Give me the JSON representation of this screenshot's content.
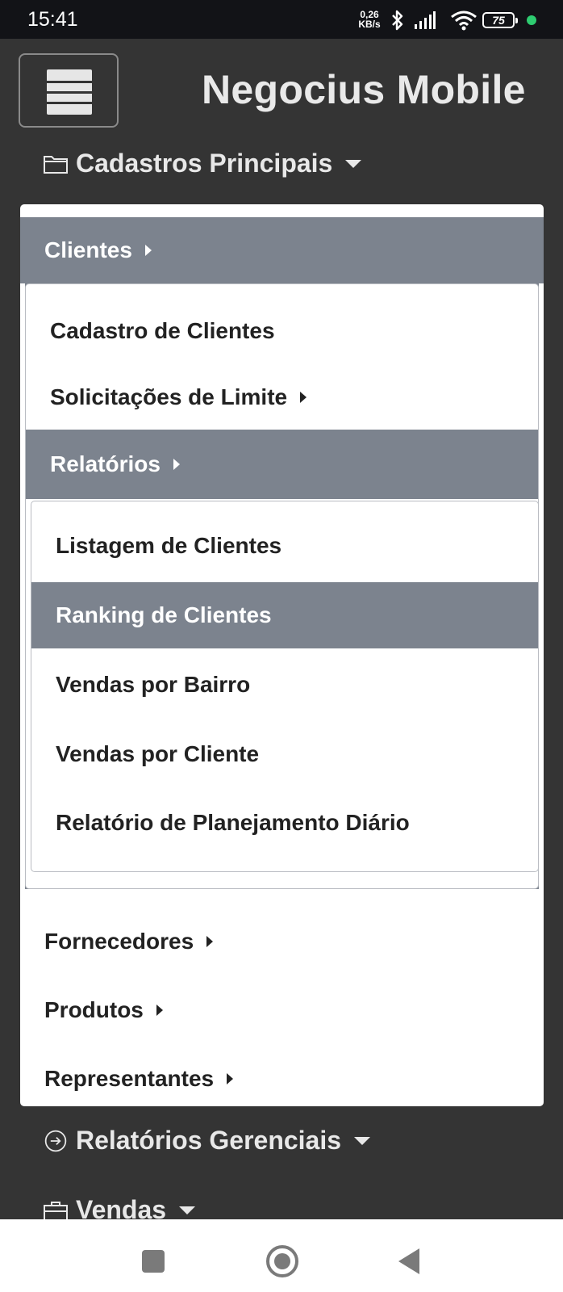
{
  "status_bar": {
    "time": "15:41",
    "net_speed_value": "0,26",
    "net_speed_unit": "KB/s",
    "battery": "75",
    "icons": [
      "bluetooth-icon",
      "signal-icon",
      "wifi-icon",
      "battery-icon",
      "charging-dot"
    ]
  },
  "header": {
    "title": "Negocius Mobile",
    "menu_icon": "hamburger-icon"
  },
  "sections": {
    "cadastros": {
      "label": "Cadastros Principais",
      "icon": "folder-icon"
    },
    "gerenciais": {
      "label": "Relatórios Gerenciais",
      "icon": "arrow-circle-right-icon"
    },
    "vendas": {
      "label": "Vendas",
      "icon": "briefcase-icon"
    }
  },
  "menu": {
    "clientes": "Clientes",
    "clientes_sub": {
      "cadastro": "Cadastro de Clientes",
      "solicitacoes": "Solicitações de Limite",
      "relatorios": "Relatórios",
      "relatorios_sub": [
        "Listagem de Clientes",
        "Ranking de Clientes",
        "Vendas por Bairro",
        "Vendas por Cliente",
        "Relatório de Planejamento Diário"
      ]
    },
    "fornecedores": "Fornecedores",
    "produtos": "Produtos",
    "representantes": "Representantes"
  },
  "colors": {
    "background": "#343434",
    "highlight": "#7c838e",
    "menu_bg": "#ffffff",
    "text_dark": "#222222"
  },
  "nav_bar": {
    "buttons": [
      "recents-button",
      "home-button",
      "back-button"
    ]
  }
}
